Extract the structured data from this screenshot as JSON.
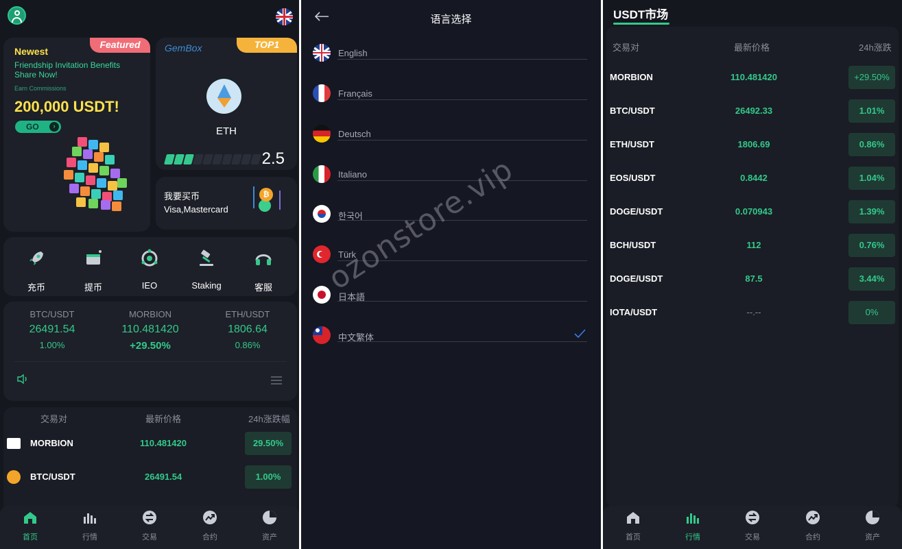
{
  "home": {
    "promo": {
      "ribbon": "Featured",
      "newest": "Newest",
      "line1": "Friendship Invitation Benefits",
      "line2": "Share Now!",
      "earn": "Earn Commissions",
      "amount": "200,000 USDT!",
      "go": "GO"
    },
    "gembox": {
      "name": "GemBox",
      "ribbon": "TOP1",
      "coin": "ETH",
      "value": "2.5",
      "progress_segments_filled": 3,
      "progress_segments_total": 10
    },
    "buy": {
      "title": "我要买币",
      "subtitle": "Visa,Mastercard",
      "coin_symbol": "₿"
    },
    "actions": [
      {
        "label": "充币",
        "icon": "rocket-icon"
      },
      {
        "label": "提币",
        "icon": "wallet-icon"
      },
      {
        "label": "IEO",
        "icon": "ieo-icon"
      },
      {
        "label": "Staking",
        "icon": "hammer-icon"
      },
      {
        "label": "客服",
        "icon": "headset-icon"
      }
    ],
    "tickers": [
      {
        "pair": "BTC/USDT",
        "price": "26491.54",
        "change": "1.00%"
      },
      {
        "pair": "MORBION",
        "price": "110.481420",
        "change": "+29.50%"
      },
      {
        "pair": "ETH/USDT",
        "price": "1806.64",
        "change": "0.86%"
      }
    ],
    "market": {
      "headers": [
        "交易对",
        "最新价格",
        "24h涨跌幅"
      ],
      "rows": [
        {
          "symbol": "MORBION",
          "price": "110.481420",
          "change": "29.50%"
        },
        {
          "symbol": "BTC/USDT",
          "price": "26491.54",
          "change": "1.00%"
        }
      ]
    }
  },
  "tabbar": [
    {
      "label": "首页",
      "icon": "home-icon"
    },
    {
      "label": "行情",
      "icon": "chart-bars-icon"
    },
    {
      "label": "交易",
      "icon": "trade-icon"
    },
    {
      "label": "合约",
      "icon": "contract-icon"
    },
    {
      "label": "资产",
      "icon": "pie-icon"
    }
  ],
  "language": {
    "title": "语言选择",
    "options": [
      {
        "name": "English",
        "flag": "uk-flag-icon"
      },
      {
        "name": "Français",
        "flag": "france-flag-icon"
      },
      {
        "name": "Deutsch",
        "flag": "germany-flag-icon"
      },
      {
        "name": "Italiano",
        "flag": "italy-flag-icon"
      },
      {
        "name": "한국어",
        "flag": "korea-flag-icon"
      },
      {
        "name": "Türk",
        "flag": "turkey-flag-icon"
      },
      {
        "name": "日本語",
        "flag": "japan-flag-icon"
      },
      {
        "name": "中文繁体",
        "flag": "taiwan-flag-icon",
        "selected": true
      }
    ]
  },
  "watermark": "ozonstore.vip",
  "usdt_market": {
    "title": "USDT市场",
    "headers": [
      "交易对",
      "最新价格",
      "24h涨跌"
    ],
    "rows": [
      {
        "symbol": "MORBION",
        "price": "110.481420",
        "change": "+29.50%"
      },
      {
        "symbol": "BTC/USDT",
        "price": "26492.33",
        "change": "1.01%"
      },
      {
        "symbol": "ETH/USDT",
        "price": "1806.69",
        "change": "0.86%"
      },
      {
        "symbol": "EOS/USDT",
        "price": "0.8442",
        "change": "1.04%"
      },
      {
        "symbol": "DOGE/USDT",
        "price": "0.070943",
        "change": "1.39%"
      },
      {
        "symbol": "BCH/USDT",
        "price": "112",
        "change": "0.76%"
      },
      {
        "symbol": "DOGE/USDT",
        "price": "87.5",
        "change": "3.44%"
      },
      {
        "symbol": "IOTA/USDT",
        "price": "--.--",
        "change": "0%"
      }
    ]
  },
  "colors": {
    "accent": "#33c98b",
    "background": "#15171f",
    "card": "#1d2028",
    "featured": "#f06c77",
    "top1": "#f6b33b"
  }
}
